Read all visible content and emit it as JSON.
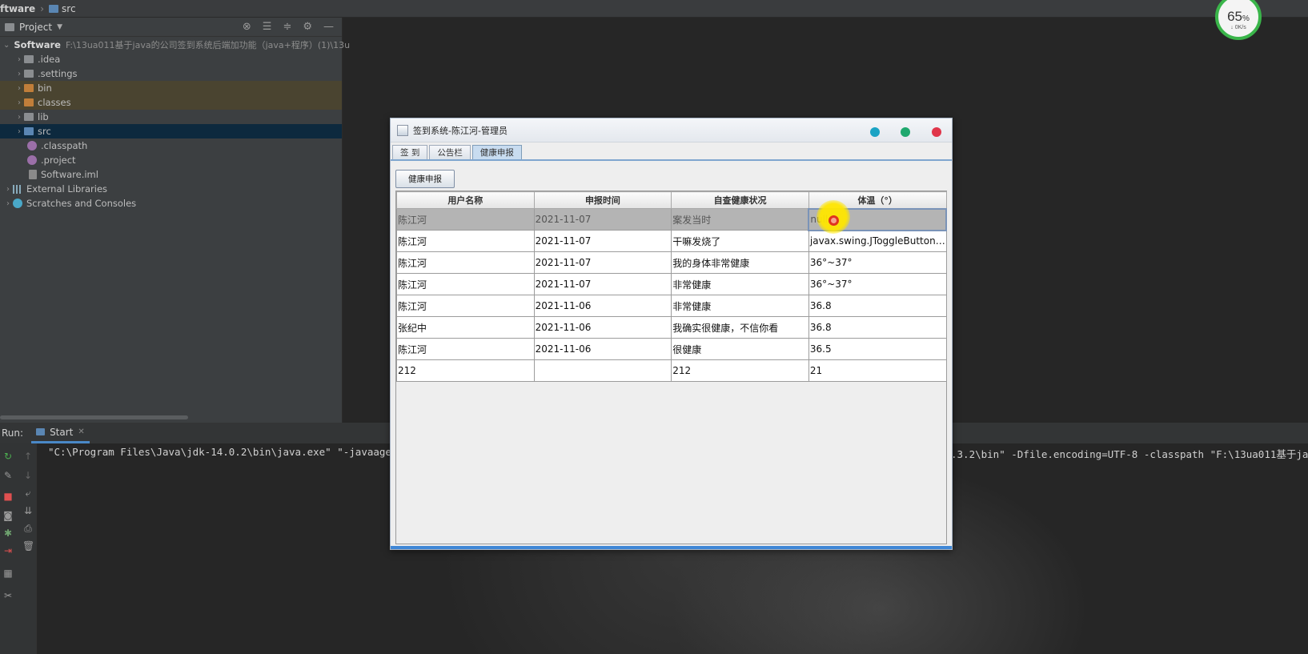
{
  "breadcrumb": {
    "project": "ftware",
    "folder": "src"
  },
  "project_panel": {
    "title": "Project",
    "root": {
      "name": "Software",
      "path": "F:\\13ua011基于java的公司签到系统后端加功能（java+程序）(1)\\13u"
    },
    "items": [
      {
        "label": ".idea",
        "type": "folder"
      },
      {
        "label": ".settings",
        "type": "folder"
      },
      {
        "label": "bin",
        "type": "folder-orange"
      },
      {
        "label": "classes",
        "type": "folder-orange"
      },
      {
        "label": "lib",
        "type": "folder"
      },
      {
        "label": "src",
        "type": "folder-blue"
      },
      {
        "label": ".classpath",
        "type": "file"
      },
      {
        "label": ".project",
        "type": "file"
      },
      {
        "label": "Software.iml",
        "type": "file-iml"
      }
    ],
    "external_libraries": "External Libraries",
    "scratches": "Scratches and Consoles"
  },
  "run_panel": {
    "label": "Run:",
    "tab": "Start",
    "console_left": "\"C:\\Program Files\\Java\\jdk-14.0.2\\bin\\java.exe\" \"-javaagent:",
    "console_right": ".3.2\\bin\" -Dfile.encoding=UTF-8 -classpath \"F:\\13ua011基于java的"
  },
  "gauge": {
    "percent": "65",
    "percent_unit": "%",
    "speed": "0K/s"
  },
  "app_window": {
    "title": "签到系统-陈江河-管理员",
    "controls": {
      "min_color": "#1aa3c4",
      "max_color": "#1fa86e",
      "close_color": "#e0354a"
    },
    "tabs": [
      "签 到",
      "公告栏",
      "健康申报"
    ],
    "active_tab": 2,
    "report_button": "健康申报",
    "table": {
      "headers": [
        "用户名称",
        "申报时间",
        "自查健康状况",
        "体温（°）"
      ],
      "rows": [
        [
          "陈江河",
          "2021-11-07",
          "案发当时",
          "null"
        ],
        [
          "陈江河",
          "2021-11-07",
          "干嘛发烧了",
          "javax.swing.JToggleButton$..."
        ],
        [
          "陈江河",
          "2021-11-07",
          "我的身体非常健康",
          "36°~37°"
        ],
        [
          "陈江河",
          "2021-11-07",
          "非常健康",
          "36°~37°"
        ],
        [
          "陈江河",
          "2021-11-06",
          "非常健康",
          "36.8"
        ],
        [
          "张纪中",
          "2021-11-06",
          "我确实很健康，不信你看",
          "36.8"
        ],
        [
          "陈江河",
          "2021-11-06",
          "很健康",
          "36.5"
        ],
        [
          "212",
          "",
          "212",
          "21"
        ]
      ],
      "selected_row": 0
    }
  }
}
